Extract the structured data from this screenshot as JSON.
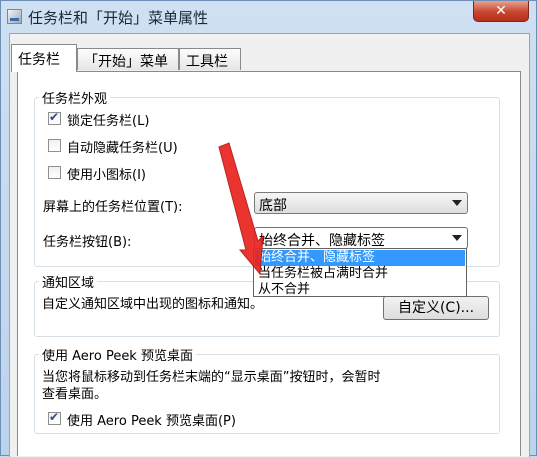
{
  "window": {
    "title": "任务栏和「开始」菜单属性",
    "close_label": "✕"
  },
  "tabs": [
    {
      "label": "任务栏",
      "active": true
    },
    {
      "label": "「开始」菜单",
      "active": false
    },
    {
      "label": "工具栏",
      "active": false
    }
  ],
  "appearance": {
    "title": "任务栏外观",
    "lock_taskbar": {
      "label": "锁定任务栏(L)",
      "checked": true
    },
    "auto_hide": {
      "label": "自动隐藏任务栏(U)",
      "checked": false
    },
    "small_icons": {
      "label": "使用小图标(I)",
      "checked": false
    },
    "position_label": "屏幕上的任务栏位置(T):",
    "position_value": "底部",
    "buttons_label": "任务栏按钮(B):",
    "buttons_value": "始终合并、隐藏标签",
    "buttons_options": [
      "始终合并、隐藏标签",
      "当任务栏被占满时合并",
      "从不合并"
    ]
  },
  "notification": {
    "title": "通知区域",
    "description": "自定义通知区域中出现的图标和通知。",
    "customize_label": "自定义(C)..."
  },
  "aero_peek": {
    "title": "使用 Aero Peek 预览桌面",
    "description_line1": "当您将鼠标移动到任务栏末端的“显示桌面”按钮时，会暂时",
    "description_line2": "查看桌面。",
    "checkbox": {
      "label": "使用 Aero Peek 预览桌面(P)",
      "checked": true
    }
  },
  "colors": {
    "highlight": "#3399ff",
    "annotation_arrow": "#e8231f"
  }
}
